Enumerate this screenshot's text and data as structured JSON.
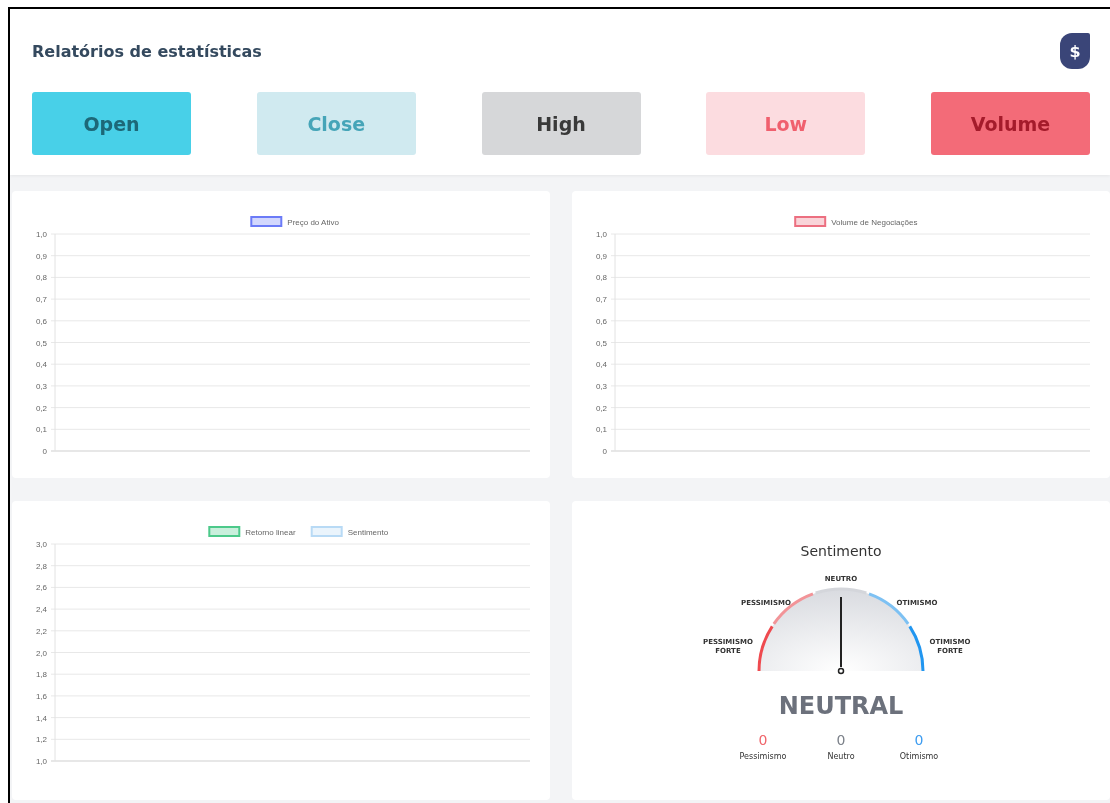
{
  "header": {
    "title": "Relatórios de estatísticas",
    "badge": "$"
  },
  "buttons": [
    {
      "label": "Open",
      "kind": "cyan"
    },
    {
      "label": "Close",
      "kind": "cyan-light"
    },
    {
      "label": "High",
      "kind": "grey"
    },
    {
      "label": "Low",
      "kind": "red-light"
    },
    {
      "label": "Volume",
      "kind": "red"
    }
  ],
  "charts": [
    {
      "chart_data": {
        "type": "line",
        "grid": true,
        "series": [
          {
            "name": "Preço do Ativo",
            "color": "#6b7bf7"
          }
        ],
        "ylim": [
          0,
          1
        ],
        "yticks": [
          {
            "value": 0,
            "label": "0"
          },
          {
            "value": 0.1,
            "label": "0,1"
          },
          {
            "value": 0.2,
            "label": "0,2"
          },
          {
            "value": 0.3,
            "label": "0,3"
          },
          {
            "value": 0.4,
            "label": "0,4"
          },
          {
            "value": 0.5,
            "label": "0,5"
          },
          {
            "value": 0.6,
            "label": "0,6"
          },
          {
            "value": 0.7,
            "label": "0,7"
          },
          {
            "value": 0.8,
            "label": "0,8"
          },
          {
            "value": 0.9,
            "label": "0,9"
          },
          {
            "value": 1,
            "label": "1,0"
          }
        ]
      }
    },
    {
      "chart_data": {
        "type": "line",
        "grid": true,
        "series": [
          {
            "name": "Volume de Negociações",
            "color": "#ec6f80"
          }
        ],
        "ylim": [
          0,
          1
        ],
        "yticks": [
          {
            "value": 0,
            "label": "0"
          },
          {
            "value": 0.1,
            "label": "0,1"
          },
          {
            "value": 0.2,
            "label": "0,2"
          },
          {
            "value": 0.3,
            "label": "0,3"
          },
          {
            "value": 0.4,
            "label": "0,4"
          },
          {
            "value": 0.5,
            "label": "0,5"
          },
          {
            "value": 0.6,
            "label": "0,6"
          },
          {
            "value": 0.7,
            "label": "0,7"
          },
          {
            "value": 0.8,
            "label": "0,8"
          },
          {
            "value": 0.9,
            "label": "0,9"
          },
          {
            "value": 1,
            "label": "1,0"
          }
        ]
      }
    },
    {
      "chart_data": {
        "type": "line",
        "grid": true,
        "series": [
          {
            "name": "Retorno linear",
            "color": "#4cc98a"
          },
          {
            "name": "Sentimento",
            "color": "#b8daf5"
          }
        ],
        "ylim": [
          1,
          3
        ],
        "yticks": [
          {
            "value": 1,
            "label": "1,0"
          },
          {
            "value": 1.2,
            "label": "1,2"
          },
          {
            "value": 1.4,
            "label": "1,4"
          },
          {
            "value": 1.6,
            "label": "1,6"
          },
          {
            "value": 1.8,
            "label": "1,8"
          },
          {
            "value": 2,
            "label": "2,0"
          },
          {
            "value": 2.2,
            "label": "2,2"
          },
          {
            "value": 2.4,
            "label": "2,4"
          },
          {
            "value": 2.6,
            "label": "2,6"
          },
          {
            "value": 2.8,
            "label": "2,8"
          },
          {
            "value": 3,
            "label": "3,0"
          }
        ]
      }
    }
  ],
  "sentiment": {
    "title": "Sentimento",
    "gauge": {
      "level": 0.5,
      "segments": [
        {
          "label": "PESSIMISMO FORTE",
          "color": "#ef4a4f"
        },
        {
          "label": "PESSIMISMO",
          "color": "#f29498"
        },
        {
          "label": "NEUTRO",
          "color": "#d4d6db"
        },
        {
          "label": "OTIMISMO",
          "color": "#7dc1f3"
        },
        {
          "label": "OTIMISMO FORTE",
          "color": "#2196f0"
        }
      ]
    },
    "verdict": "NEUTRAL",
    "counts": [
      {
        "value": "0",
        "label": "Pessimismo",
        "color": "#f0646a"
      },
      {
        "value": "0",
        "label": "Neutro",
        "color": "#7b8089"
      },
      {
        "value": "0",
        "label": "Otimismo",
        "color": "#3d9cf0"
      }
    ]
  }
}
